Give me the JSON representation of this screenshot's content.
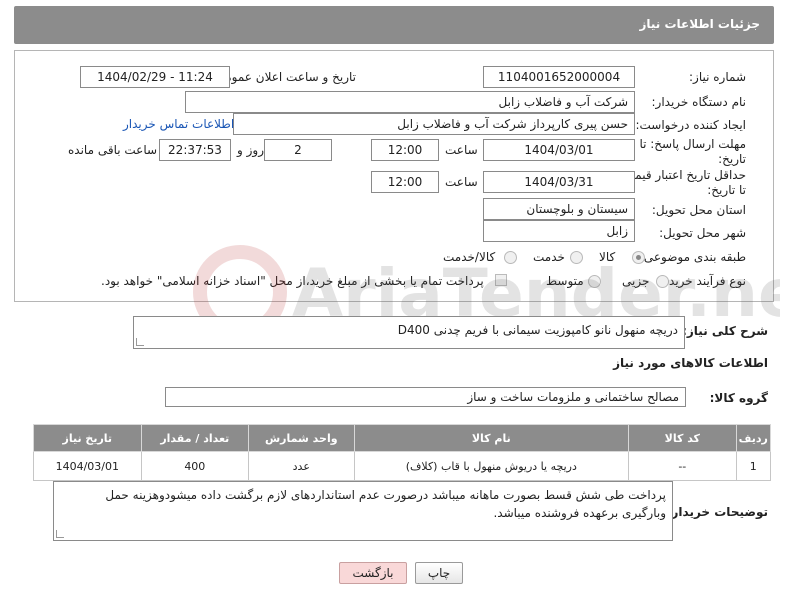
{
  "header": {
    "title": "جزئیات اطلاعات نیاز"
  },
  "form": {
    "need_number": {
      "label": "شماره نیاز:",
      "value": "1104001652000004"
    },
    "announce_datetime": {
      "label": "تاریخ و ساعت اعلان عمومی:",
      "value": "1404/02/29 - 11:24"
    },
    "buyer_org": {
      "label": "نام دستگاه خریدار:",
      "value": "شرکت آب و فاضلاب زابل"
    },
    "creator": {
      "label": "ایجاد کننده درخواست:",
      "value": "حسن پیری کارپرداز شرکت آب و فاضلاب زابل",
      "contact_link": "اطلاعات تماس خریدار"
    },
    "reply_deadline": {
      "label_line1": "مهلت ارسال پاسخ: تا",
      "label_line2": "تاریخ:",
      "date": "1404/03/01",
      "time_label": "ساعت",
      "time": "12:00",
      "days": "2",
      "days_label": "روز و",
      "remaining": "22:37:53",
      "remaining_label": "ساعت باقی مانده"
    },
    "price_validity": {
      "label_line1": "حداقل تاریخ اعتبار قیمت:",
      "label_line2": "تا تاریخ:",
      "date": "1404/03/31",
      "time_label": "ساعت",
      "time": "12:00"
    },
    "province": {
      "label": "استان محل تحویل:",
      "value": "سیستان و بلوچستان"
    },
    "city": {
      "label": "شهر محل تحویل:",
      "value": "زابل"
    },
    "category": {
      "label": "طبقه بندی موضوعی:",
      "options": [
        "کالا",
        "خدمت",
        "کالا/خدمت"
      ],
      "selected": "کالا"
    },
    "purchase_type": {
      "label": "نوع فرآیند خرید :",
      "options": [
        "جزیی",
        "متوسط"
      ],
      "checkbox_text": "پرداخت تمام یا بخشی از مبلغ خرید،از محل \"اسناد خزانه اسلامی\" خواهد بود."
    }
  },
  "description": {
    "label": "شرح کلی نیاز:",
    "value": "دریچه منهول نانو کامپوزیت سیمانی با فریم چدنی D400"
  },
  "goods": {
    "section_title": "اطلاعات کالاهای مورد نیاز",
    "group_label": "گروه کالا:",
    "group_value": "مصالح ساختمانی و ملزومات ساخت و ساز",
    "columns": [
      "ردیف",
      "کد کالا",
      "نام کالا",
      "واحد شمارش",
      "تعداد / مقدار",
      "تاریخ نیاز"
    ],
    "rows": [
      {
        "row": "1",
        "code": "--",
        "name": "دریچه یا دریوش منهول با قاب (کلاف)",
        "unit": "عدد",
        "qty": "400",
        "date": "1404/03/01"
      }
    ]
  },
  "buyer_notes": {
    "label": "توضیحات خریدار:",
    "value": "پرداخت طی شش قسط بصورت ماهانه میباشد درصورت عدم استانداردهای لازم برگشت داده میشودوهزینه حمل وبارگیری برعهده فروشنده میباشد."
  },
  "actions": {
    "print_label": "چاپ",
    "back_label": "بازگشت"
  },
  "watermark": {
    "text": "AriaTender.neT"
  },
  "colors": {
    "header_bg": "#8c8c8c",
    "link": "#1a56b5",
    "back_button_bg": "#f9d8d8"
  }
}
